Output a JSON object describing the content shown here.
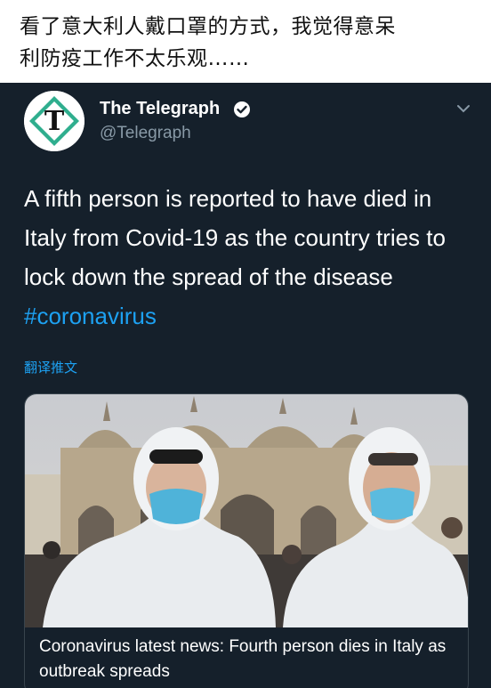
{
  "caption": {
    "line1": "看了意大利人戴口罩的方式，我觉得意呆",
    "line2": "利防疫工作不太乐观……"
  },
  "tweet": {
    "display_name": "The Telegraph",
    "handle": "@Telegraph",
    "text_main": "A fifth person is reported to have died in Italy from Covid-19 as the country tries to lock down the spread of the disease ",
    "hashtag": "#coronavirus",
    "translate_label": "翻译推文",
    "card_title": "Coronavirus latest news: Fourth person dies in Italy as outbreak spreads",
    "avatar_letter": "T"
  },
  "colors": {
    "background": "#15202b",
    "link": "#1da1f2",
    "muted": "#8899a6",
    "logo_green": "#2fae8e"
  },
  "icons": {
    "verified": "verified-badge-icon",
    "more": "chevron-down-icon"
  }
}
